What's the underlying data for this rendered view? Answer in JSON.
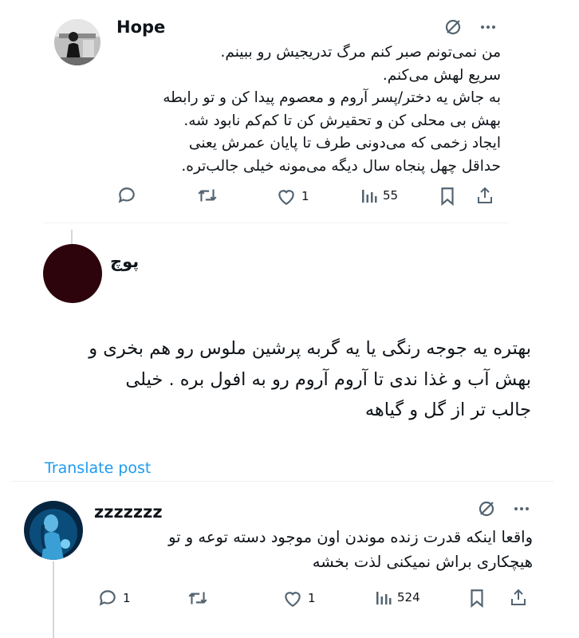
{
  "posts": [
    {
      "author": "Hope",
      "lines": [
        "من نمی‌تونم صبر کنم مرگ تدریجیش رو ببینم.",
        "سریع لهش می‌کنم.",
        "به جاش یه دختر/پسر آروم و معصوم پیدا کن و تو رابطه",
        "بهش بی محلی کن و تحقیرش کن تا کم‌کم نابود شه.",
        "ایجاد زخمی که می‌دونی طرف تا پایان عمرش یعنی",
        "حداقل چهل پنجاه سال دیگه می‌مونه خیلی جالب‌تره."
      ],
      "stats": {
        "replies": "",
        "reposts": "",
        "likes": "1",
        "views": "55"
      },
      "icons": [
        "grok-icon",
        "more-icon"
      ]
    },
    {
      "author": "پوچ",
      "lines": [
        "بهتره یه جوجه رنگی یا یه گربه پرشین ملوس رو هم بخری و",
        "بهش آب و غذا ندی تا آروم آروم رو به افول بره . خیلی",
        "جالب تر از گل و گیاهه"
      ],
      "translate_label": "Translate post"
    },
    {
      "author": "zzzzzzz",
      "lines": [
        "واقعا اینکه قدرت زنده موندن اون موجود دسته توعه و تو",
        "هیچکاری براش نمیکنی لذت بخشه"
      ],
      "stats": {
        "replies": "1",
        "reposts": "",
        "likes": "1",
        "views": "524"
      },
      "icons": [
        "grok-icon",
        "more-icon"
      ]
    }
  ],
  "colors": {
    "text": "#0f1419",
    "muted": "#536471",
    "link": "#1d9bf0",
    "divider": "#eff3f4"
  }
}
